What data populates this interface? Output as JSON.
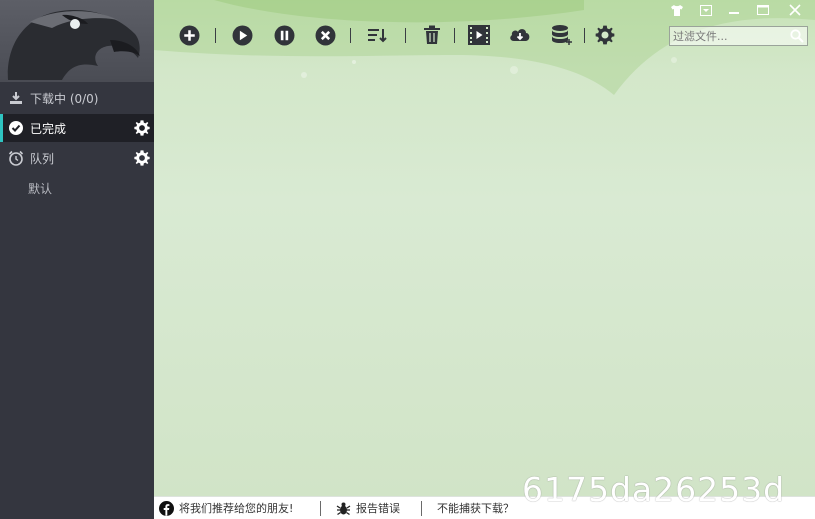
{
  "sidebar": {
    "items": [
      {
        "label": "下载中 (0/0)",
        "icon": "download-icon"
      },
      {
        "label": "已完成",
        "icon": "check-circle-icon"
      },
      {
        "label": "队列",
        "icon": "alarm-clock-icon"
      }
    ],
    "queue_sub": "默认"
  },
  "toolbar": {
    "buttons": [
      "add-icon",
      "play-icon",
      "pause-icon",
      "stop-icon",
      "sort-icon",
      "trash-icon",
      "video-icon",
      "cloud-download-icon",
      "database-icon",
      "settings-icon"
    ]
  },
  "filter": {
    "placeholder": "过滤文件..."
  },
  "statusbar": {
    "recommend": "将我们推荐给您的朋友!",
    "report": "报告错误",
    "cannot_capture": "不能捕获下载？"
  },
  "watermark": "6175da26253d",
  "colors": {
    "accent": "#2fc4c1",
    "sidebar_bg": "#34363f",
    "active_bg": "#1f2026"
  }
}
